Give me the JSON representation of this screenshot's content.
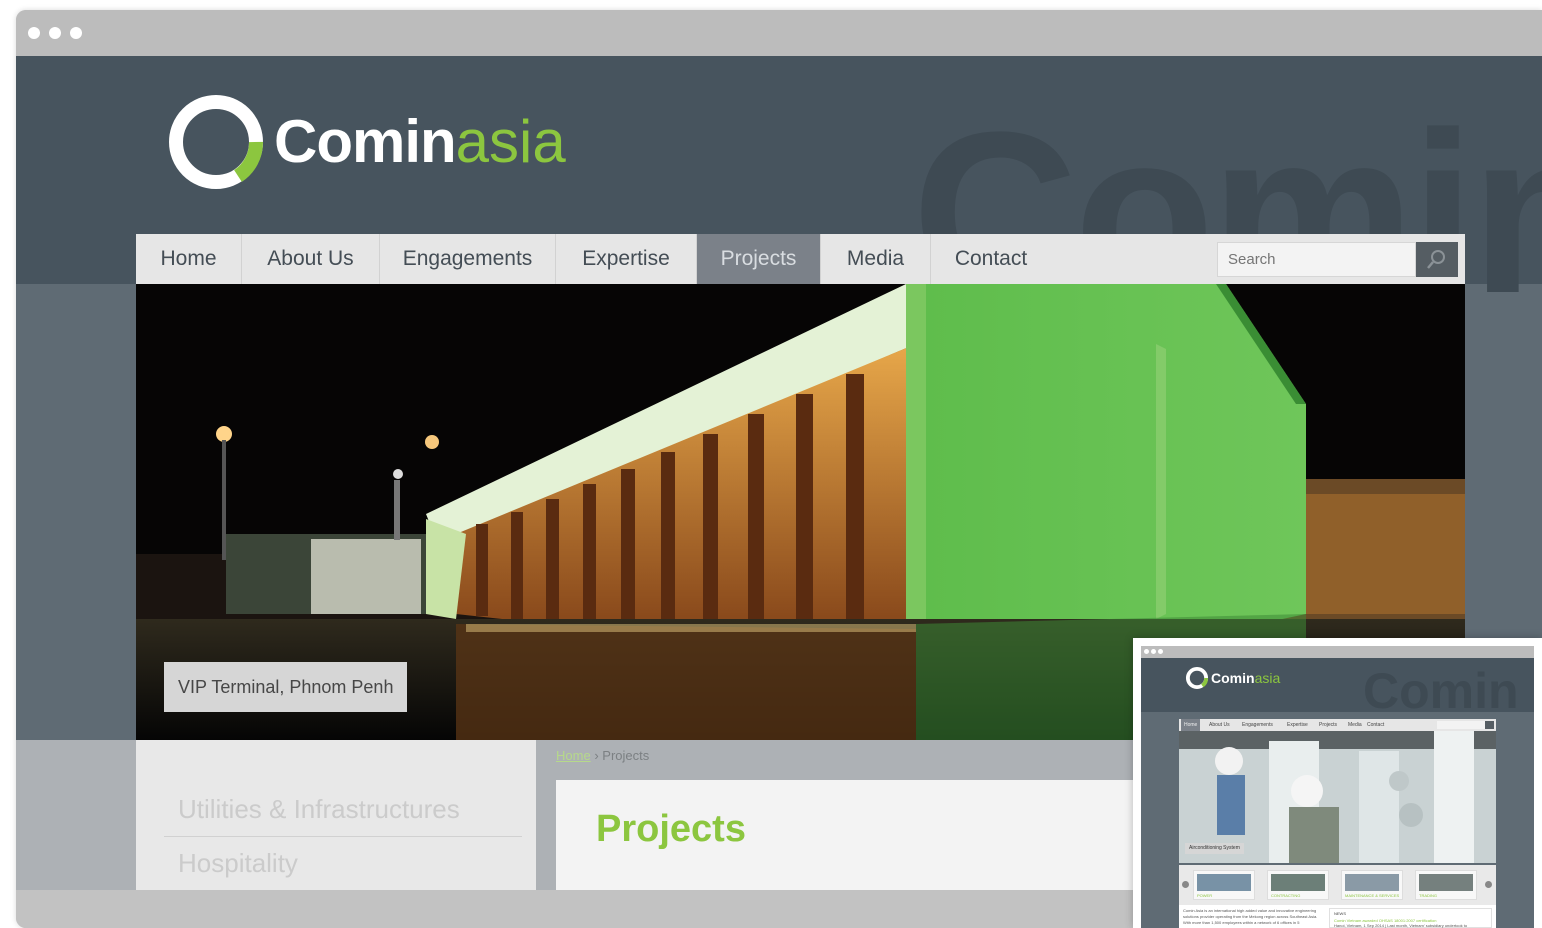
{
  "site": {
    "brand_strong": "Comin",
    "brand_light": "asia",
    "watermark": "Comin",
    "accent_color": "#8cc63f",
    "header_color": "#47545e"
  },
  "nav": {
    "items": [
      {
        "label": "Home"
      },
      {
        "label": "About Us"
      },
      {
        "label": "Engagements"
      },
      {
        "label": "Expertise"
      },
      {
        "label": "Projects",
        "active": true
      },
      {
        "label": "Media"
      },
      {
        "label": "Contact"
      }
    ],
    "search_placeholder": "Search",
    "search_icon": "magnifier-icon"
  },
  "hero": {
    "caption": "VIP Terminal, Phnom Penh"
  },
  "breadcrumb": {
    "home": "Home",
    "separator": "›",
    "current": "Projects"
  },
  "sidebar": {
    "items": [
      {
        "label": "Utilities & Infrastructures"
      },
      {
        "label": "Hospitality"
      }
    ]
  },
  "main": {
    "title": "Projects"
  },
  "thumbnail": {
    "brand_strong": "Comin",
    "brand_light": "asia",
    "watermark": "Comin",
    "nav_items": [
      "Home",
      "About Us",
      "Engagements",
      "Expertise",
      "Projects",
      "Media",
      "Contact"
    ],
    "hero_caption": "Airconditioning System",
    "cards": [
      "POWER",
      "CONTRACTING",
      "MAINTENANCE & SERVICES",
      "TRADING"
    ],
    "intro": "Comin Asia is an international high added value and innovative engineering solutions provider operating from the Mekong region across Southeast Asia.",
    "intro_2": "With more than 1,500 employees within a network of 6 offices in 5",
    "news_heading": "NEWS",
    "news_title": "Comin Vietnam awarded OHSAS 18001:2007 certification",
    "news_text": "Hanoi, Vietnam, 1 Sep 2014 | Last month, Vietnam' subsidiary undertook to"
  }
}
